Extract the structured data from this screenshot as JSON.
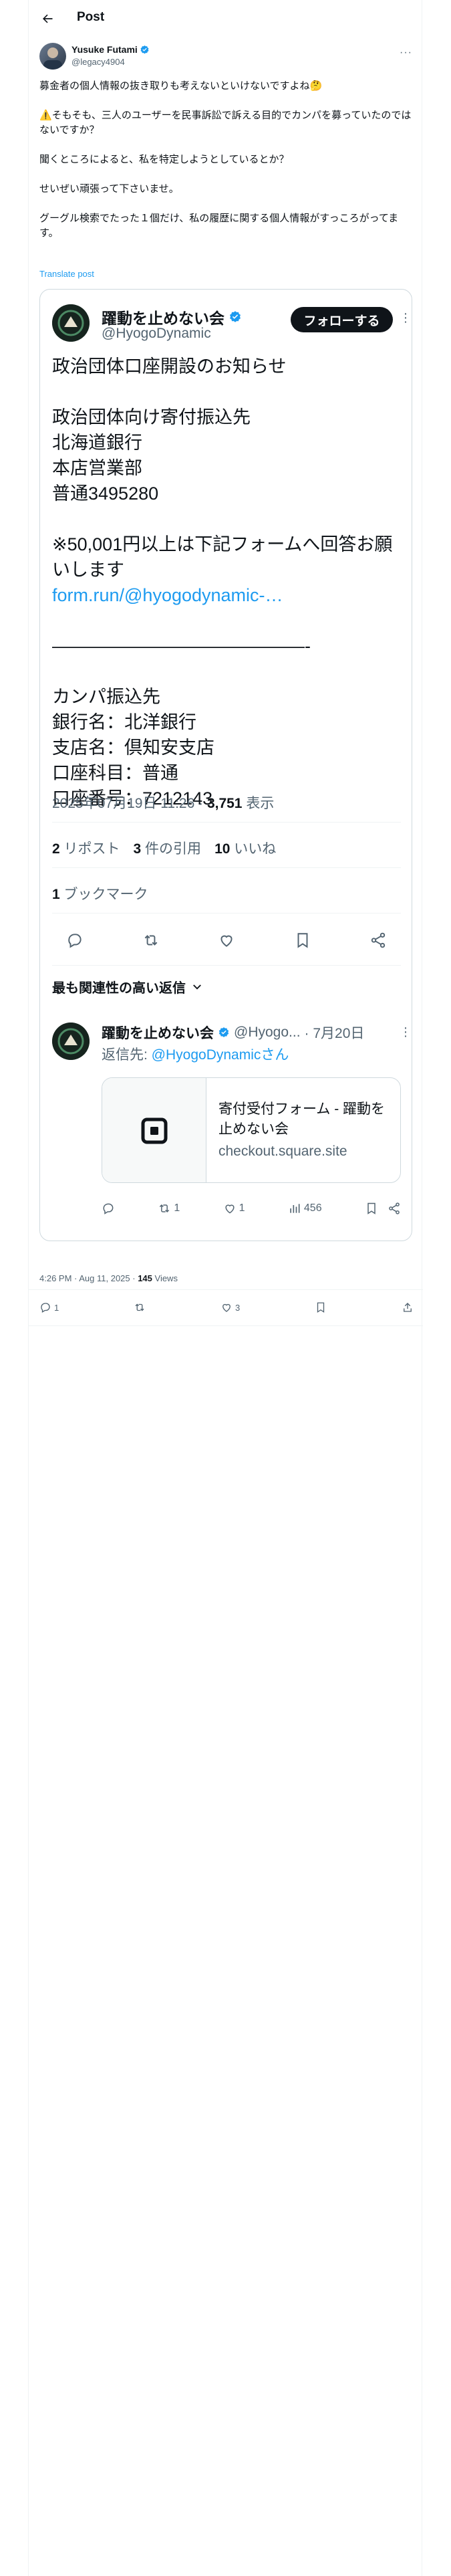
{
  "header": {
    "title": "Post"
  },
  "author": {
    "name": "Yusuke Futami",
    "handle": "@legacy4904"
  },
  "post": {
    "text": "募金者の個人情報の抜き取りも考えないといけないですよね🤔\n\n⚠️そもそも、三人のユーザーを民事訴訟で訴える目的でカンパを募っていたのではないですか？\n\n聞くところによると、私を特定しようとしているとか？\n\nせいぜい頑張って下さいませ。\n\nグーグル検索でたった１個だけ、私の履歴に関する個人情報がすっころがってます。",
    "translate": "Translate post"
  },
  "quoted": {
    "name": "躍動を止めない会",
    "handle": "@HyogoDynamic",
    "follow_label": "フォローする",
    "text_before_link": "政治団体口座開設のお知らせ\n\n政治団体向け寄付振込先\n北海道銀行\n本店営業部\n普通3495280\n\n※50,001円以上は下記フォームへ回答お願いします\n",
    "link": "form.run/@hyogodynamic-…",
    "text_after_link": "\n\n——————————————-\n\nカンパ振込先\n銀行名：北洋銀行\n支店名：倶知安支店\n口座科目：普通\n口座番号：7212143",
    "time": "2025年07月19日 11:26 · ",
    "views_count": "3,751",
    "views_label": " 表示",
    "reposts_count": "2",
    "reposts_label": " リポスト",
    "quotes_count": "3",
    "quotes_label": " 件の引用",
    "likes_count": "10",
    "likes_label": " いいね",
    "bookmarks_count": "1",
    "bookmarks_label": " ブックマーク",
    "relevant_label": "最も関連性の高い返信"
  },
  "reply": {
    "name": "躍動を止めない会",
    "handle": "@Hyogo...",
    "time": "· 7月20日",
    "replying_to_label": "返信先: ",
    "replying_to_handle": "@HyogoDynamicさん",
    "card_title": "寄付受付フォーム - 躍動を止めない会",
    "card_domain": "checkout.square.site",
    "reposts": "1",
    "likes": "1",
    "views": "456"
  },
  "meta": {
    "time": "4:26 PM · Aug 11, 2025 · ",
    "views_count": "145",
    "views_label": " Views"
  },
  "actions": {
    "replies": "1",
    "likes": "3"
  }
}
